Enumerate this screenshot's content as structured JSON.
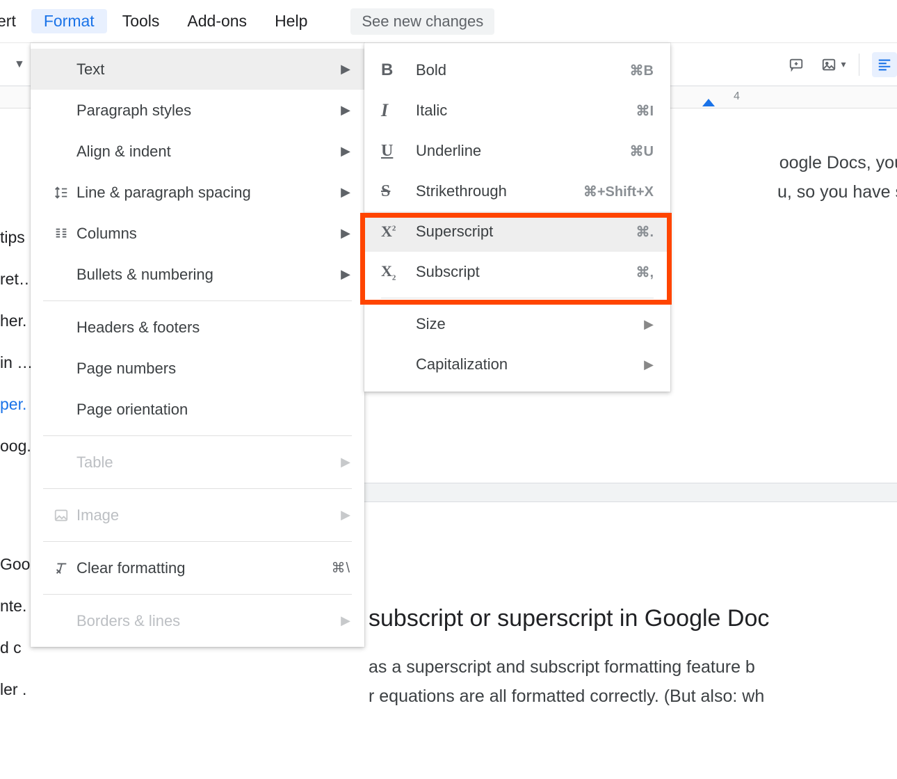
{
  "menubar": {
    "items": [
      "ert",
      "Format",
      "Tools",
      "Add-ons",
      "Help"
    ],
    "see_new": "See new changes"
  },
  "ruler": {
    "mark4": "4"
  },
  "left_fragments": {
    "tips": "tips",
    "ret": "ret…",
    "her": "her.",
    "in": "in …",
    "per": "per.",
    "pog": "oog.",
    "goo": "Goo.",
    "nte": "nte.",
    "dc": "d c",
    "ler": "ler ."
  },
  "format_menu": {
    "text": "Text",
    "paragraph_styles": "Paragraph styles",
    "align_indent": "Align & indent",
    "line_spacing": "Line & paragraph spacing",
    "columns": "Columns",
    "bullets_numbering": "Bullets & numbering",
    "headers_footers": "Headers & footers",
    "page_numbers": "Page numbers",
    "page_orientation": "Page orientation",
    "table": "Table",
    "image": "Image",
    "clear_formatting": "Clear formatting",
    "clear_shortcut": "⌘\\",
    "borders_lines": "Borders & lines"
  },
  "text_submenu": {
    "bold": {
      "label": "Bold",
      "shortcut": "⌘B"
    },
    "italic": {
      "label": "Italic",
      "shortcut": "⌘I"
    },
    "underline": {
      "label": "Underline",
      "shortcut": "⌘U"
    },
    "strikethrough": {
      "label": "Strikethrough",
      "shortcut": "⌘+Shift+X"
    },
    "superscript": {
      "label": "Superscript",
      "shortcut": "⌘."
    },
    "subscript": {
      "label": "Subscript",
      "shortcut": "⌘,"
    },
    "size": "Size",
    "capitalization": "Capitalization"
  },
  "document": {
    "line1": "oogle Docs, you",
    "line2": "u, so you have s",
    "heading": "subscript or superscript in Google Doc",
    "para1": "as a superscript and subscript formatting feature b",
    "para2": "r equations are all formatted correctly. (But also: wh"
  }
}
